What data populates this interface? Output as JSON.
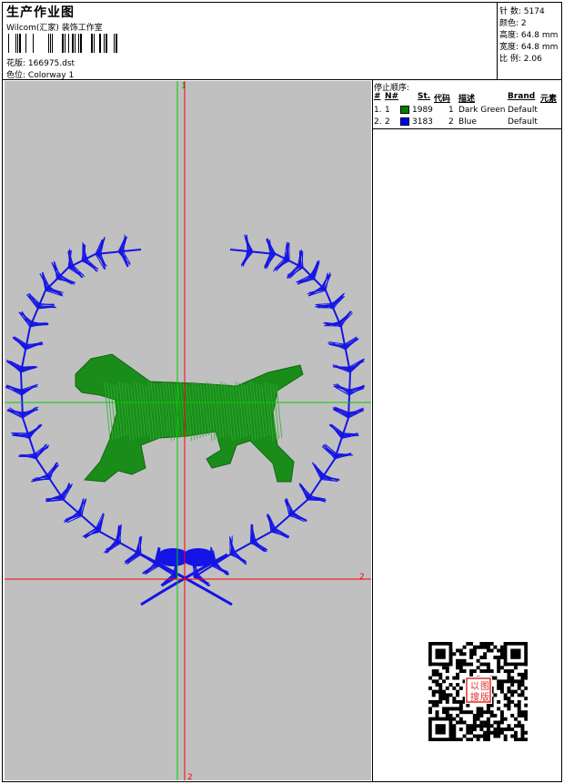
{
  "header": {
    "title": "生产作业图",
    "company": "Wilcom(汇家) 装饰工作室",
    "pattern_label": "花版:",
    "pattern_value": "166975.dst",
    "colorway_label": "色位:",
    "colorway_value": "Colorway 1"
  },
  "specs": {
    "stitches_label": "针 数:",
    "stitches_value": "5174",
    "colors_label": "颜色:",
    "colors_value": "2",
    "height_label": "高度:",
    "height_value": "64.8 mm",
    "width_label": "宽度:",
    "width_value": "64.8 mm",
    "ratio_label": "比 例:",
    "ratio_value": "2.06"
  },
  "design": {
    "axis_top_marker": "1",
    "axis_right_marker": "2",
    "axis_bottom_marker": "2",
    "green_color": "#1a8c1a",
    "blue_color": "#1414e6",
    "guide_green": "#00cc00",
    "guide_red": "#ff0000"
  },
  "stop_sequence": {
    "title": "停止顺序:",
    "columns": [
      "#",
      "N#",
      "St.",
      "代码",
      "描述",
      "Brand",
      "元素"
    ],
    "rows": [
      {
        "idx": "1.",
        "n": "1",
        "color": "#008000",
        "stitches": "1989",
        "code": "1",
        "desc": "Dark Green",
        "brand": "Default"
      },
      {
        "idx": "2.",
        "n": "2",
        "color": "#0000ff",
        "stitches": "3183",
        "code": "2",
        "desc": "Blue",
        "brand": "Default"
      }
    ]
  },
  "qr": {
    "stamp_text": "以图搜版"
  }
}
